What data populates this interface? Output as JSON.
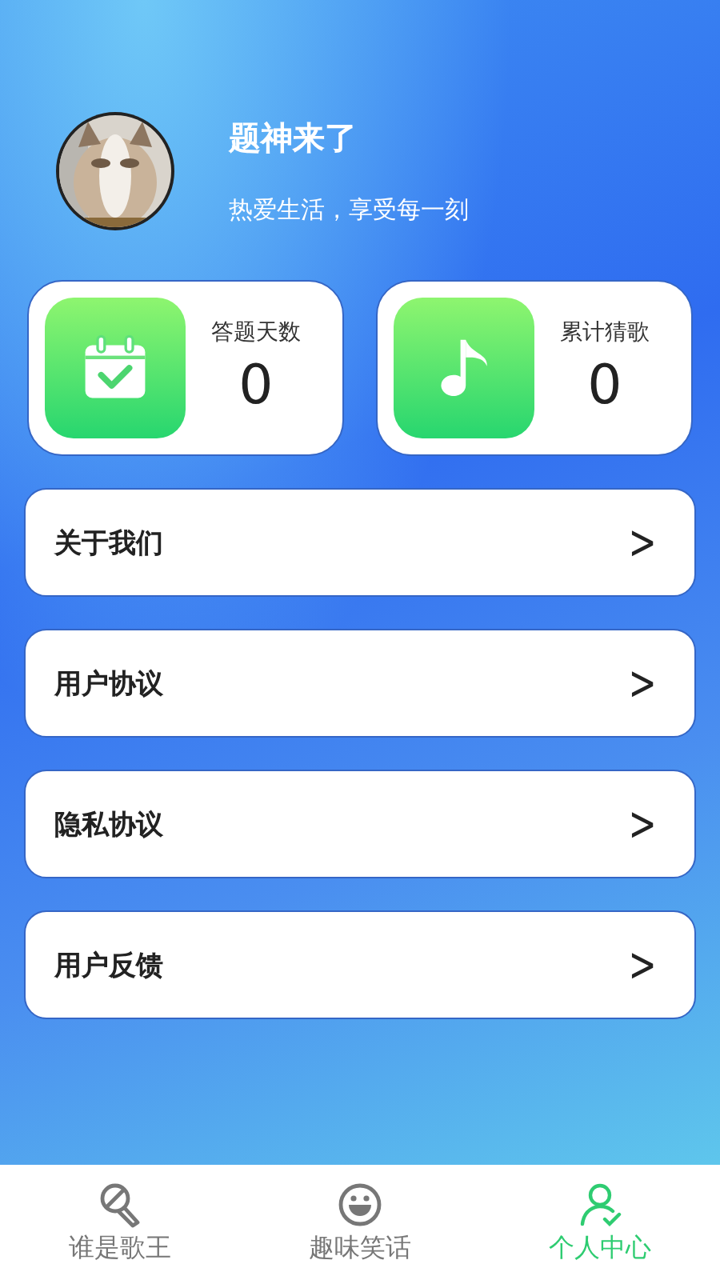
{
  "profile": {
    "name": "题神来了",
    "motto": "热爱生活，享受每一刻"
  },
  "stats": [
    {
      "kind": "calendar",
      "label": "答题天数",
      "value": "0"
    },
    {
      "kind": "music",
      "label": "累计猜歌",
      "value": "0"
    }
  ],
  "menu": [
    {
      "label": "关于我们",
      "chevron": ">"
    },
    {
      "label": "用户协议",
      "chevron": ">"
    },
    {
      "label": "隐私协议",
      "chevron": ">"
    },
    {
      "label": "用户反馈",
      "chevron": ">"
    }
  ],
  "tabs": [
    {
      "kind": "mic",
      "label": "谁是歌王",
      "selected": false
    },
    {
      "kind": "smile",
      "label": "趣味笑话",
      "selected": false
    },
    {
      "kind": "person",
      "label": "个人中心",
      "selected": true
    }
  ]
}
